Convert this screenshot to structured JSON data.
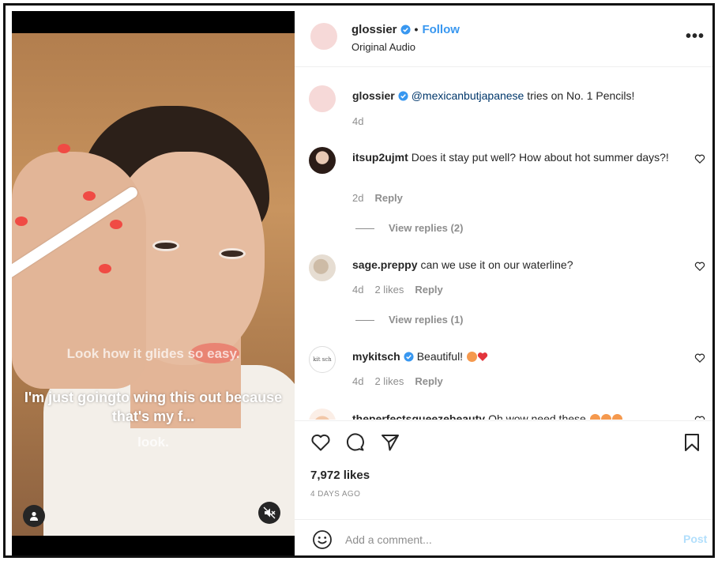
{
  "post": {
    "username": "glossier",
    "follow_label": "Follow",
    "audio_label": "Original Audio",
    "more_label": "•••"
  },
  "video": {
    "caption_1": "Look how it glides so easy.",
    "caption_2": "I'm just goingto wing this out because that's my f...",
    "caption_3": "look.",
    "icons": {
      "user": "user-icon",
      "mute": "muted-speaker-icon"
    }
  },
  "caption_comment": {
    "username": "glossier",
    "mention": "@mexicanbutjapanese",
    "text": " tries on No. 1 Pencils!",
    "time": "4d"
  },
  "comments": [
    {
      "username": "itsup2ujmt",
      "text": "Does it stay put well? How about hot summer days?!",
      "time": "2d",
      "likes": "",
      "reply": "Reply",
      "view_replies": "View replies (2)"
    },
    {
      "username": "sage.preppy",
      "text": "can we use it on our waterline?",
      "time": "4d",
      "likes": "2 likes",
      "reply": "Reply",
      "view_replies": "View replies (1)"
    },
    {
      "username": "mykitsch",
      "text": "Beautiful! ",
      "time": "4d",
      "likes": "2 likes",
      "reply": "Reply",
      "avatar_text": "kit sch"
    },
    {
      "username": "theperfectsqueezebeauty",
      "text": "Oh wow need these ",
      "time": "",
      "likes": "",
      "reply": ""
    }
  ],
  "stats": {
    "likes": "7,972 likes",
    "posted": "4 DAYS AGO"
  },
  "add_comment": {
    "placeholder": "Add a comment...",
    "post_label": "Post"
  },
  "colors": {
    "accent": "#3897f0",
    "mention": "#00376b",
    "muted": "#8e8e8e",
    "post_disabled": "#b2dffc",
    "avatar_pink": "#f6d9d8"
  }
}
